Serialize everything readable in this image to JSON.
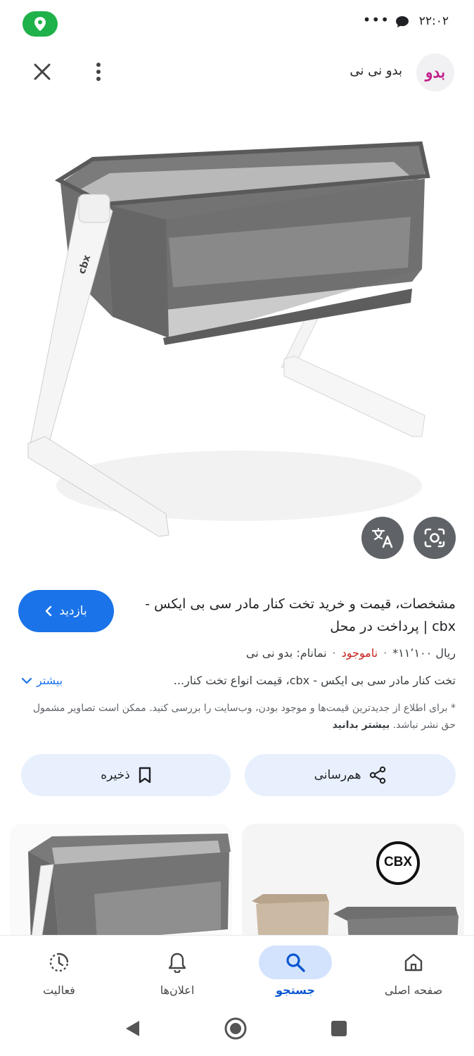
{
  "status_bar": {
    "time": "۲۲:۰۲",
    "dots": "•••",
    "location_pill_color": "#1fb14a"
  },
  "header": {
    "site_logo_text": "بدو",
    "site_name": "بدو نی نی"
  },
  "product": {
    "title": "مشخصات، قیمت و خرید تخت کنار مادر سی بی ایکس - cbx | پرداخت در محل",
    "visit_label": "بازدید",
    "price": "ریال ۱۱٬۱۰۰*",
    "availability": "ناموجود",
    "brand": "نمانام: بدو نی نی",
    "snippet": "تخت کنار مادر سی بی ایکس - cbx، قیمت انواع تخت کنار...",
    "more_label": "بیشتر",
    "disclaimer": "* برای اطلاع از جدیدترین قیمت‌ها و موجود بودن، وب‌سایت را بررسی کنید. ممکن است تصاویر مشمول حق نشر نباشد.",
    "disclaimer_link": "بیشتر بدانید"
  },
  "actions": {
    "share_label": "هم‌رسانی",
    "save_label": "ذخیره"
  },
  "related": {
    "card2_logo": "CBX"
  },
  "bottom_nav": {
    "items": [
      {
        "label": "صفحه اصلی",
        "icon": "home-icon"
      },
      {
        "label": "جستجو",
        "icon": "search-icon"
      },
      {
        "label": "اعلان‌ها",
        "icon": "bell-icon"
      },
      {
        "label": "فعالیت",
        "icon": "activity-icon"
      }
    ],
    "active_index": 1
  },
  "colors": {
    "accent": "#1a73e8",
    "out_of_stock": "#c5221f",
    "tonal_button": "#e8f0fe",
    "logo": "#c2208c"
  }
}
